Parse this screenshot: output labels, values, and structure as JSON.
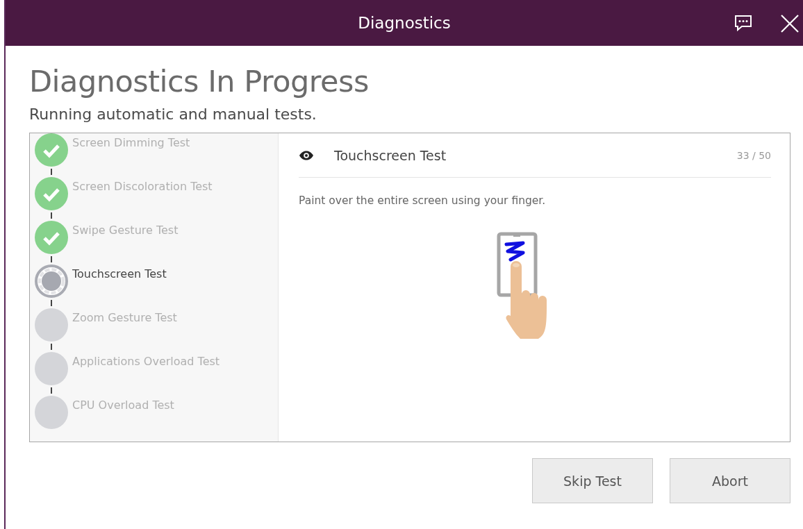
{
  "window": {
    "title": "Diagnostics"
  },
  "heading": "Diagnostics In Progress",
  "subheading": "Running automatic and manual tests.",
  "steps": [
    {
      "name": "Screen Dimming Test",
      "kind": "done"
    },
    {
      "name": "Screen Discoloration Test",
      "kind": "done"
    },
    {
      "name": "Swipe Gesture Test",
      "kind": "done"
    },
    {
      "name": "Touchscreen Test",
      "kind": "running"
    },
    {
      "name": "Zoom Gesture Test",
      "kind": "pending"
    },
    {
      "name": "Applications Overload Test",
      "kind": "pending"
    },
    {
      "name": "CPU Overload Test",
      "kind": "pending"
    }
  ],
  "current_test": {
    "name": "Touchscreen Test",
    "counter": "33 / 50",
    "instruction": "Paint over the entire screen using your finger."
  },
  "buttons": [
    "Skip Test",
    "Abort"
  ]
}
